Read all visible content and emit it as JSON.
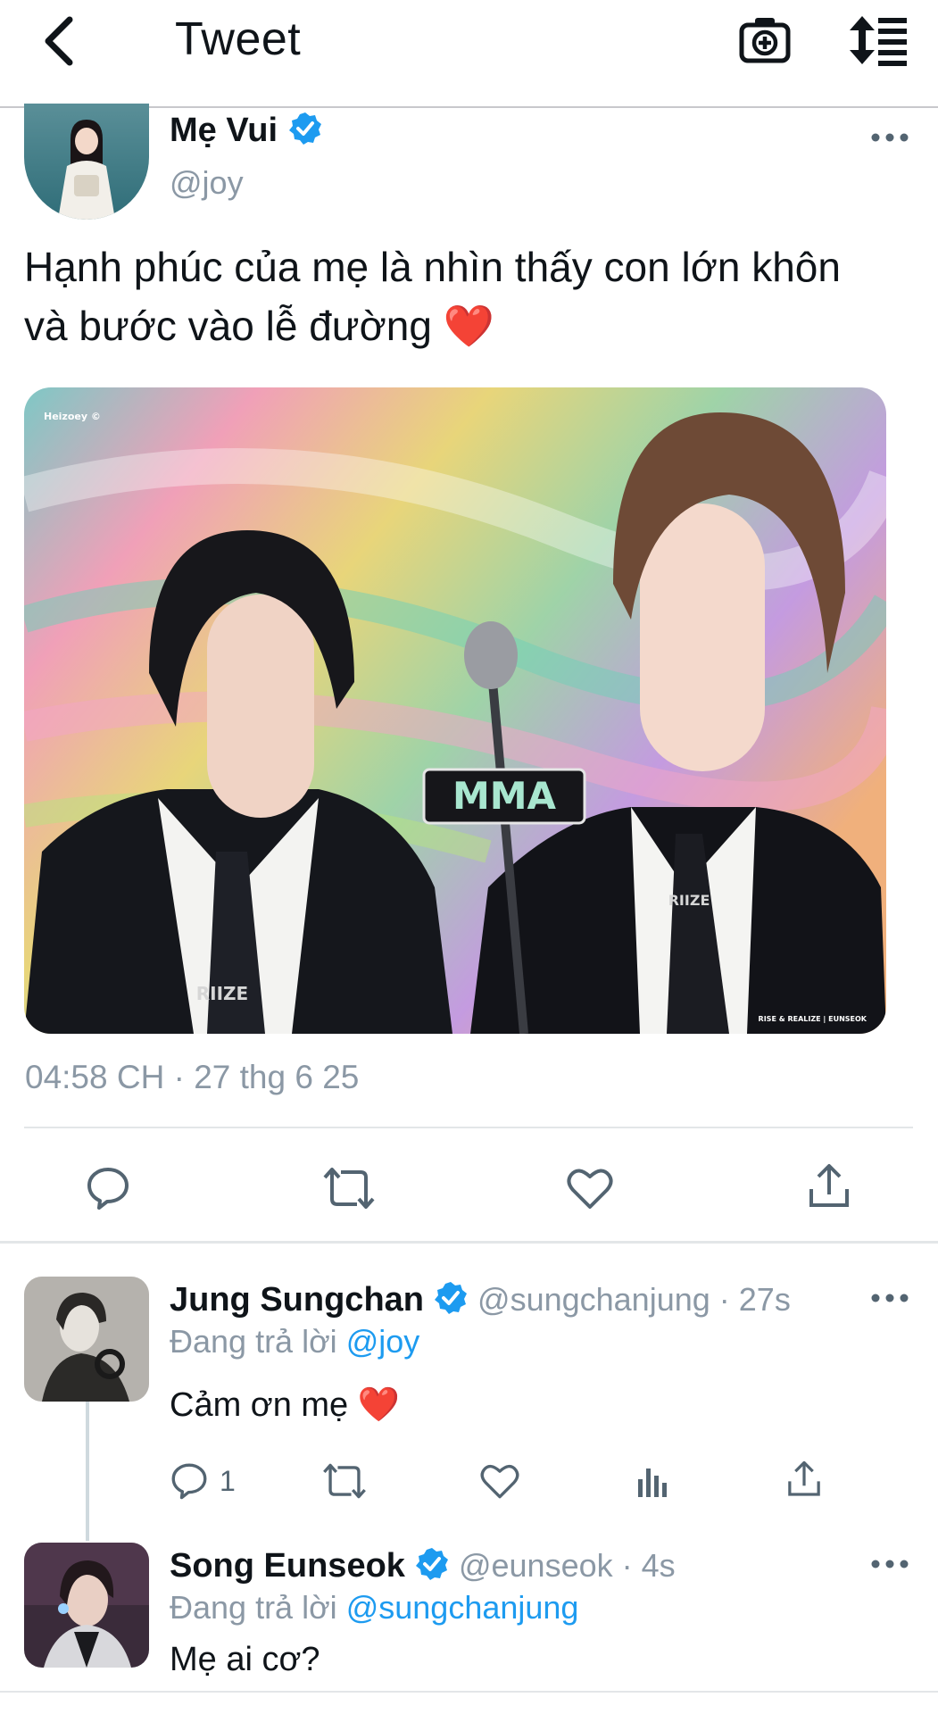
{
  "header": {
    "title": "Tweet",
    "back_icon": "chevron-left-icon",
    "camera_icon": "camera-plus-icon",
    "sort_icon": "sort-updown-icon"
  },
  "main_tweet": {
    "name": "Mẹ Vui",
    "handle": "@joy",
    "text_line1": "Hạnh phúc của mẹ là nhìn thấy con lớn khôn",
    "text_line2": "và bước vào lễ đường",
    "emoji": "❤️",
    "media": {
      "watermark_top": "Heizoey ©",
      "sign_text": "MMA",
      "tie_left": "RIIZE",
      "tie_right": "RIIZE",
      "watermark_bottom": "RISE & REALIZE | EUNSEOK"
    },
    "timestamp": "04:58 CH · 27 thg 6 25",
    "actions": [
      "reply-icon",
      "retweet-icon",
      "like-icon",
      "share-icon"
    ]
  },
  "replies": [
    {
      "name": "Jung Sungchan",
      "handle": "@sungchanjung",
      "time": "· 27s",
      "replying_label": "Đang trả lời",
      "replying_to": "@joy",
      "text": "Cảm ơn mẹ",
      "emoji": "❤️",
      "reply_count": "1"
    },
    {
      "name": "Song Eunseok",
      "handle": "@eunseok",
      "time": "· 4s",
      "replying_label": "Đang trả lời",
      "replying_to": "@sungchanjung",
      "text": "Mẹ ai cơ?"
    }
  ],
  "colors": {
    "accent": "#1d9bf0",
    "muted": "#8b98a5",
    "text": "#0f1419",
    "heart": "#e0202f"
  }
}
